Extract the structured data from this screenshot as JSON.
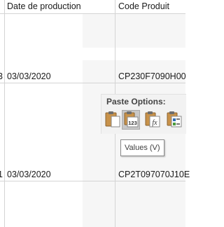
{
  "columns": {
    "date_header": "Date de production",
    "code_header": "Code Produit"
  },
  "rows": [
    {
      "row_edge": "3",
      "date": "03/03/2020",
      "code": "CP230F7090H00"
    },
    {
      "row_edge": "1",
      "date": "03/03/2020",
      "code": "CP2T097070J10E"
    }
  ],
  "paste_options": {
    "title": "Paste Options:",
    "icons": [
      "paste-icon",
      "paste-values-icon",
      "paste-formulas-icon",
      "paste-formatting-icon"
    ],
    "values_badge": "123",
    "formulas_badge": "fx"
  },
  "tooltip": "Values (V)"
}
